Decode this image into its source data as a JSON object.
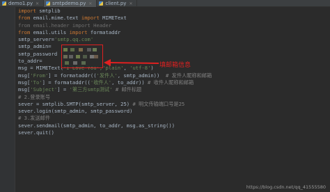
{
  "tabs": [
    {
      "label": "demo1.py"
    },
    {
      "label": "smtpdemo.py"
    },
    {
      "label": "client.py"
    }
  ],
  "code": {
    "l1": {
      "kw": "import",
      "rest": " smtplib"
    },
    "l2": {
      "kw1": "from",
      "mod": " email.mime.text ",
      "kw2": "import",
      "rest": " MIMEText"
    },
    "l3": {
      "text": "from email.header import Header"
    },
    "l4": {
      "kw1": "from",
      "mod": " email.utils ",
      "kw2": "import",
      "rest": " formataddr"
    },
    "l5": {
      "var": "smtp_server=",
      "str": "'smtp.qq.com'"
    },
    "l6": {
      "var": "smtp_admin="
    },
    "l7": {
      "var": "smtp_password"
    },
    "l8": {
      "var": "to_addr="
    },
    "l9": {
      "pre": "msg = MIMEText(",
      "str": "'I Love You','plain'",
      "sep": ", ",
      "str2": "'utf-8'",
      "post": ")"
    },
    "l10": {
      "pre": "msg[",
      "str": "'From'",
      "mid": "] = formataddr((",
      "str2": "'发件人'",
      "post": ", smtp_admin))  ",
      "cmt": "# 发件人昵称和邮箱"
    },
    "l11": {
      "pre": "msg[",
      "str": "'To'",
      "mid": "] = formataddr((",
      "str2": "'收件人'",
      "post": ", to_addr)) ",
      "cmt": "# 收件人昵称和邮箱"
    },
    "l12": {
      "pre": "msg[",
      "str": "'Subject'",
      "mid": "] = ",
      "str2": "'第三方smtp测试'",
      "post": " ",
      "cmt": "# 邮件标题"
    },
    "l13": {
      "cmt": "# 2.登录账号"
    },
    "l14": {
      "pre": "sever = smtplib.SMTP(smtp_server, 25) ",
      "cmt": "# 明文传输端口号是25"
    },
    "l15": {
      "pre": "sever.login(smtp_admin, smtp_password)"
    },
    "l16": {
      "cmt": "# 3.发送邮件"
    },
    "l17": {
      "pre": "sever.sendmail(smtp_admin, to_addr, msg.as_string())"
    },
    "l18": {
      "pre": "sever.quit()"
    }
  },
  "annotation": "填邮箱信息",
  "watermark": "https://blog.csdn.net/qq_41555580",
  "colors": {
    "highlight": "#e02020",
    "background": "#2b2b2b"
  }
}
